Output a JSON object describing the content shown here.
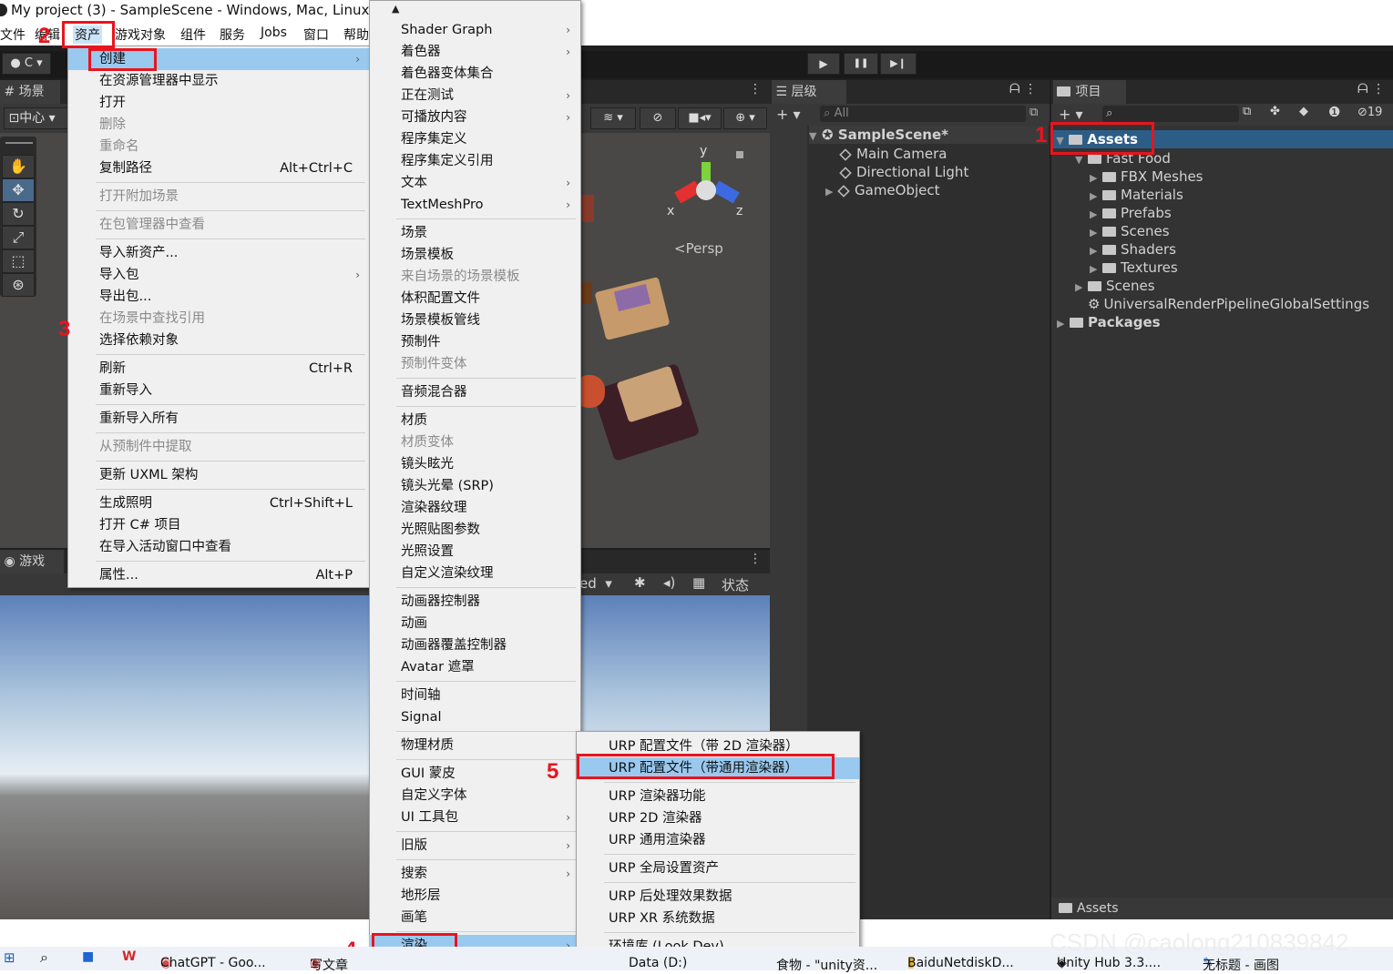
{
  "title": "My project (3) - SampleScene - Windows, Mac, Linux -",
  "menubar": [
    "文件",
    "编辑",
    "资产",
    "游戏对象",
    "组件",
    "服务",
    "Jobs",
    "窗口",
    "帮助"
  ],
  "toolbar": {
    "account": "C",
    "play": "▶",
    "pause": "❚❚",
    "step": "▶❙"
  },
  "scene": {
    "tab": "场景",
    "pivot": "中心",
    "persp": "<Persp",
    "axis_x": "x",
    "axis_y": "y",
    "axis_z": "z"
  },
  "game": {
    "tab": "游戏",
    "stats_label": "状态",
    "display_partial": "ed"
  },
  "hierarchy": {
    "tab": "层级",
    "search_placeholder": "All",
    "scene": "SampleScene*",
    "items": [
      "Main Camera",
      "Directional Light",
      "GameObject"
    ]
  },
  "project": {
    "tab": "项目",
    "hidden_count": "19",
    "root": "Assets",
    "tree": [
      {
        "label": "Fast Food",
        "depth": 1
      },
      {
        "label": "FBX Meshes",
        "depth": 2
      },
      {
        "label": "Materials",
        "depth": 2
      },
      {
        "label": "Prefabs",
        "depth": 2
      },
      {
        "label": "Scenes",
        "depth": 2
      },
      {
        "label": "Shaders",
        "depth": 2
      },
      {
        "label": "Textures",
        "depth": 2
      },
      {
        "label": "Scenes",
        "depth": 1
      },
      {
        "label": "UniversalRenderPipelineGlobalSettings",
        "depth": 1
      }
    ],
    "packages": "Packages",
    "footer_path": "Assets"
  },
  "assets_menu": [
    {
      "label": "创建",
      "arrow": "›",
      "hl": true
    },
    {
      "label": "在资源管理器中显示"
    },
    {
      "label": "打开"
    },
    {
      "label": "删除",
      "dis": true
    },
    {
      "label": "重命名",
      "dis": true
    },
    {
      "label": "复制路径",
      "sc": "Alt+Ctrl+C"
    },
    {
      "sep": true
    },
    {
      "label": "打开附加场景",
      "dis": true
    },
    {
      "sep": true
    },
    {
      "label": "在包管理器中查看",
      "dis": true
    },
    {
      "sep": true
    },
    {
      "label": "导入新资产..."
    },
    {
      "label": "导入包",
      "arrow": "›"
    },
    {
      "label": "导出包..."
    },
    {
      "label": "在场景中查找引用",
      "dis": true
    },
    {
      "label": "选择依赖对象"
    },
    {
      "sep": true
    },
    {
      "label": "刷新",
      "sc": "Ctrl+R"
    },
    {
      "label": "重新导入"
    },
    {
      "sep": true
    },
    {
      "label": "重新导入所有"
    },
    {
      "sep": true
    },
    {
      "label": "从预制件中提取",
      "dis": true
    },
    {
      "sep": true
    },
    {
      "label": "更新 UXML 架构"
    },
    {
      "sep": true
    },
    {
      "label": "生成照明",
      "sc": "Ctrl+Shift+L"
    },
    {
      "label": "打开 C# 项目"
    },
    {
      "label": "在导入活动窗口中查看"
    },
    {
      "sep": true
    },
    {
      "label": "属性...",
      "sc": "Alt+P"
    }
  ],
  "create_menu": [
    {
      "label": "Shader Graph",
      "arrow": "›"
    },
    {
      "label": "着色器",
      "arrow": "›"
    },
    {
      "label": "着色器变体集合"
    },
    {
      "label": "正在测试",
      "arrow": "›"
    },
    {
      "label": "可播放内容",
      "arrow": "›"
    },
    {
      "label": "程序集定义"
    },
    {
      "label": "程序集定义引用"
    },
    {
      "label": "文本",
      "arrow": "›"
    },
    {
      "label": "TextMeshPro",
      "arrow": "›"
    },
    {
      "sep": true
    },
    {
      "label": "场景"
    },
    {
      "label": "场景模板"
    },
    {
      "label": "来自场景的场景模板",
      "dis": true
    },
    {
      "label": "体积配置文件"
    },
    {
      "label": "场景模板管线"
    },
    {
      "label": "预制件"
    },
    {
      "label": "预制件变体",
      "dis": true
    },
    {
      "sep": true
    },
    {
      "label": "音频混合器"
    },
    {
      "sep": true
    },
    {
      "label": "材质"
    },
    {
      "label": "材质变体",
      "dis": true
    },
    {
      "label": "镜头眩光"
    },
    {
      "label": "镜头光晕 (SRP)"
    },
    {
      "label": "渲染器纹理"
    },
    {
      "label": "光照贴图参数"
    },
    {
      "label": "光照设置"
    },
    {
      "label": "自定义渲染纹理"
    },
    {
      "sep": true
    },
    {
      "label": "动画器控制器"
    },
    {
      "label": "动画"
    },
    {
      "label": "动画器覆盖控制器"
    },
    {
      "label": "Avatar 遮罩"
    },
    {
      "sep": true
    },
    {
      "label": "时间轴"
    },
    {
      "label": "Signal"
    },
    {
      "sep": true
    },
    {
      "label": "物理材质"
    },
    {
      "sep": true
    },
    {
      "label": "GUI 蒙皮"
    },
    {
      "label": "自定义字体"
    },
    {
      "label": "UI 工具包",
      "arrow": "›"
    },
    {
      "sep": true
    },
    {
      "label": "旧版",
      "arrow": "›"
    },
    {
      "sep": true
    },
    {
      "label": "搜索",
      "arrow": "›"
    },
    {
      "label": "地形层"
    },
    {
      "label": "画笔"
    },
    {
      "sep": true
    },
    {
      "label": "渲染",
      "arrow": "›",
      "hl": true
    }
  ],
  "render_menu": [
    {
      "label": "URP 配置文件（带 2D 渲染器）"
    },
    {
      "label": "URP 配置文件（带通用渲染器）",
      "hl": true
    },
    {
      "sep": true
    },
    {
      "label": "URP 渲染器功能"
    },
    {
      "label": "URP 2D 渲染器"
    },
    {
      "label": "URP 通用渲染器"
    },
    {
      "sep": true
    },
    {
      "label": "URP 全局设置资产"
    },
    {
      "sep": true
    },
    {
      "label": "URP 后处理效果数据"
    },
    {
      "label": "URP XR 系统数据"
    },
    {
      "sep": true
    },
    {
      "label": "环境库 (Look Dev)"
    }
  ],
  "annotations": [
    "1",
    "2",
    "3",
    "4",
    "5"
  ],
  "watermark": "CSDN @caolong210839842",
  "taskbar": [
    "ChatGPT - Goo...",
    "写文章",
    "Data (D:)",
    "食物 - \"unity资...",
    "BaiduNetdiskD...",
    "Unity Hub 3.3....",
    "无标题 - 画图"
  ],
  "colors": {
    "highlight": "#99c9ef",
    "annotation": "#e8141e",
    "editor_bg": "#383838",
    "selection": "#2c5d87"
  }
}
